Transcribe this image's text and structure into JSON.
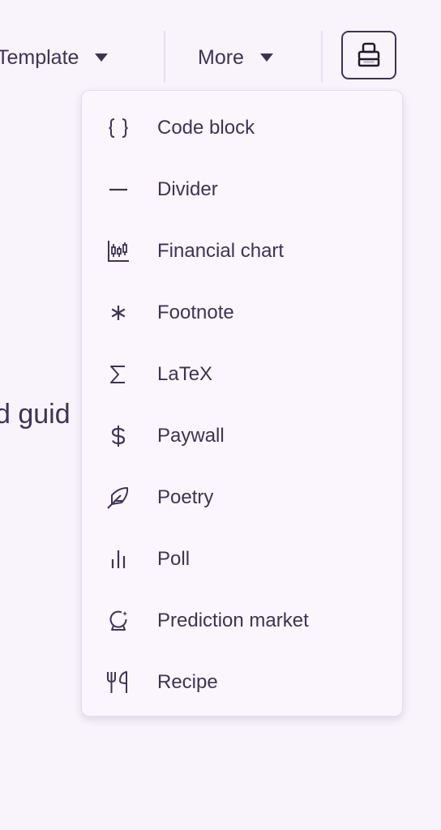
{
  "toolbar": {
    "template_label": "Template",
    "more_label": "More",
    "icon_button": "stamp-icon"
  },
  "background": {
    "partial_text": "d guid"
  },
  "menu": {
    "items": [
      {
        "label": "Code block",
        "icon": "code-braces-icon"
      },
      {
        "label": "Divider",
        "icon": "minus-icon"
      },
      {
        "label": "Financial chart",
        "icon": "candlestick-chart-icon"
      },
      {
        "label": "Footnote",
        "icon": "asterisk-icon"
      },
      {
        "label": "LaTeX",
        "icon": "sigma-icon"
      },
      {
        "label": "Paywall",
        "icon": "dollar-icon"
      },
      {
        "label": "Poetry",
        "icon": "feather-icon"
      },
      {
        "label": "Poll",
        "icon": "bar-chart-icon"
      },
      {
        "label": "Prediction market",
        "icon": "crystal-ball-icon"
      },
      {
        "label": "Recipe",
        "icon": "utensils-icon"
      }
    ]
  }
}
